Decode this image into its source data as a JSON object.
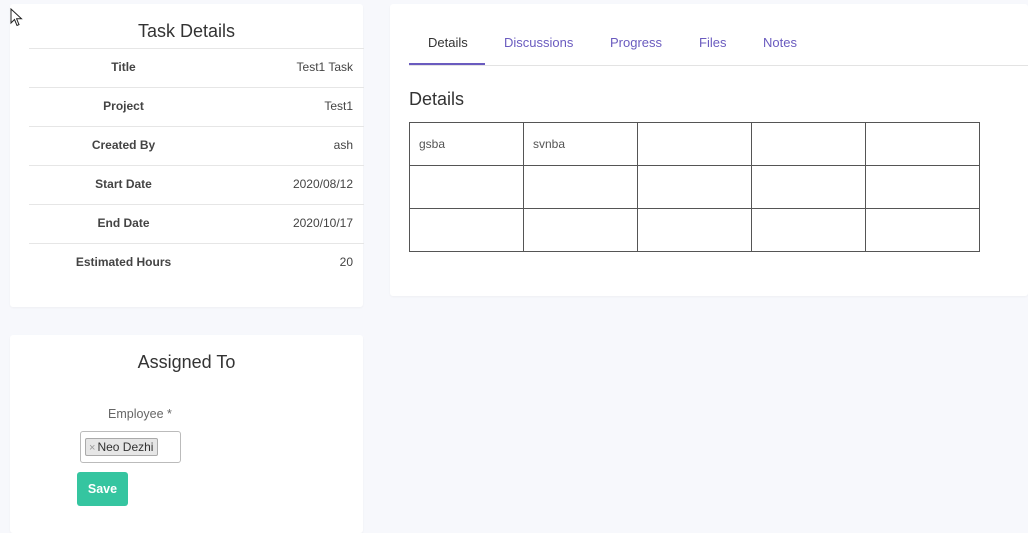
{
  "task_details": {
    "title": "Task Details",
    "rows": [
      {
        "label": "Title",
        "value": "Test1 Task"
      },
      {
        "label": "Project",
        "value": "Test1"
      },
      {
        "label": "Created By",
        "value": "ash"
      },
      {
        "label": "Start Date",
        "value": "2020/08/12"
      },
      {
        "label": "End Date",
        "value": "2020/10/17"
      },
      {
        "label": "Estimated Hours",
        "value": "20"
      }
    ]
  },
  "assigned_to": {
    "title": "Assigned To",
    "employee_label": "Employee *",
    "selected_employee": "Neo Dezhi",
    "chip_remove": "×",
    "save_label": "Save"
  },
  "tabs": [
    {
      "label": "Details",
      "active": true
    },
    {
      "label": "Discussions",
      "active": false
    },
    {
      "label": "Progress",
      "active": false
    },
    {
      "label": "Files",
      "active": false
    },
    {
      "label": "Notes",
      "active": false
    }
  ],
  "details_section": {
    "title": "Details",
    "grid": [
      [
        "gsba",
        "svnba",
        "",
        "",
        ""
      ],
      [
        "",
        "",
        "",
        "",
        ""
      ],
      [
        "",
        "",
        "",
        "",
        ""
      ]
    ]
  },
  "colors": {
    "accent": "#6a5bbf",
    "save_button": "#35c5a0",
    "background": "#f7f8fc"
  },
  "icons": {
    "cursor": "mouse-pointer-icon"
  }
}
